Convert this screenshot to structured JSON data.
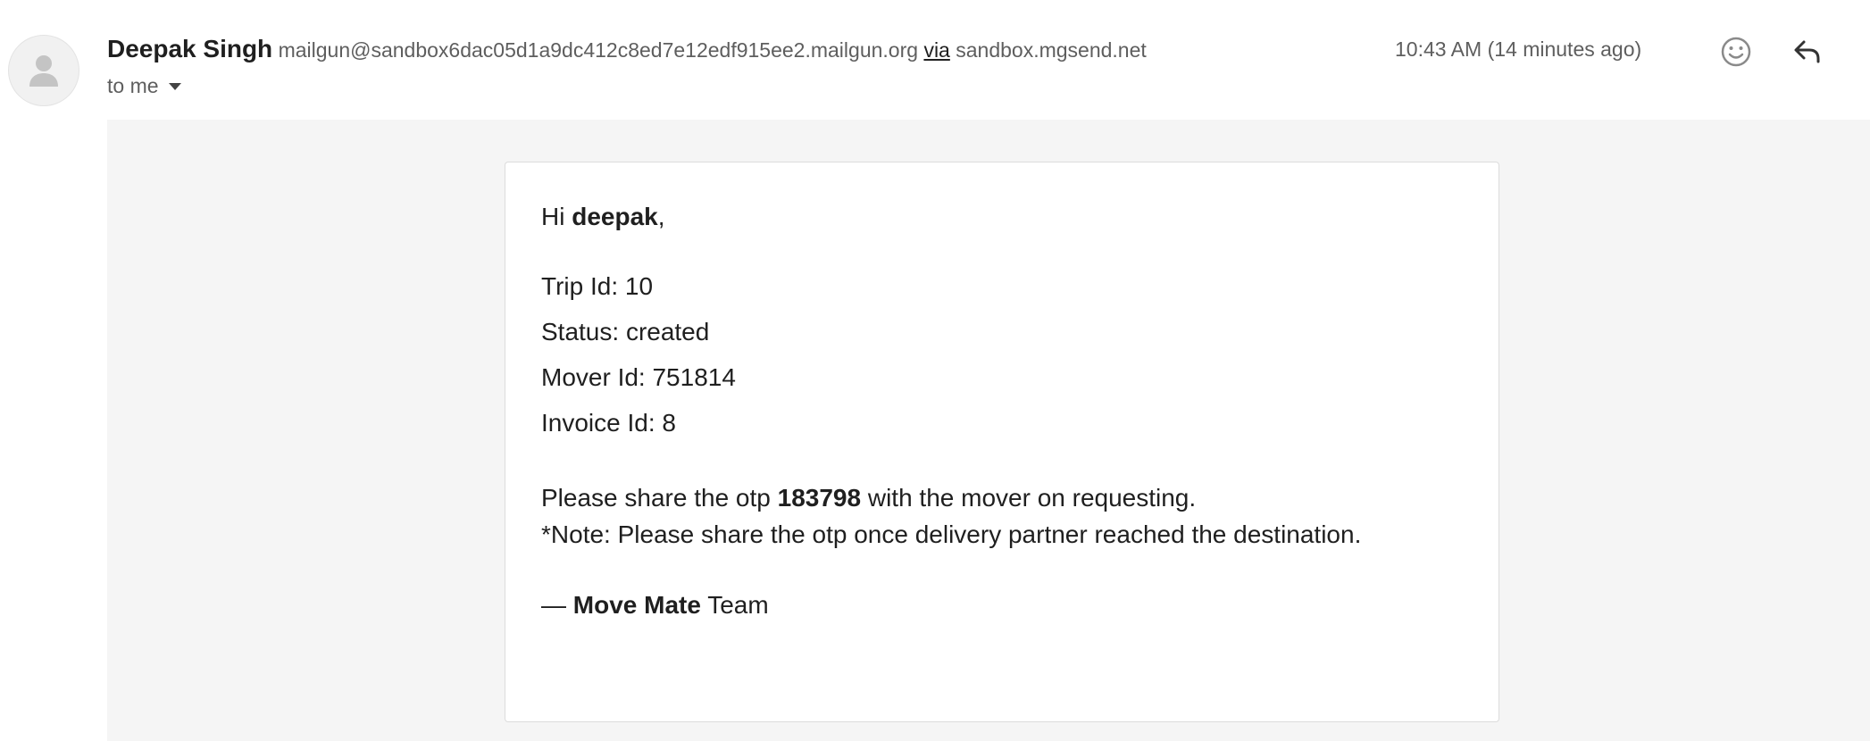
{
  "sender": {
    "name": "Deepak Singh",
    "email": "mailgun@sandbox6dac05d1a9dc412c8ed7e12edf915ee2.mailgun.org",
    "via_label": "via",
    "via_domain": "sandbox.mgsend.net"
  },
  "recipient": {
    "label": "to me"
  },
  "timestamp": "10:43 AM (14 minutes ago)",
  "icons": {
    "avatar": "person-icon",
    "emoji": "emoji-icon",
    "reply": "reply-icon",
    "dropdown": "caret-down-icon"
  },
  "message": {
    "greeting_prefix": "Hi ",
    "greeting_name": "deepak",
    "greeting_suffix": ",",
    "fields": [
      {
        "label": "Trip Id: ",
        "value": "10"
      },
      {
        "label": "Status: ",
        "value": "created"
      },
      {
        "label": "Mover Id: ",
        "value": "751814"
      },
      {
        "label": "Invoice Id: ",
        "value": "8"
      }
    ],
    "otp_prefix": "Please share the otp ",
    "otp": "183798",
    "otp_suffix": " with the mover on requesting.",
    "note": "*Note: Please share the otp once delivery partner reached the destination.",
    "signoff_dash": "— ",
    "signoff_brand": "Move Mate",
    "signoff_suffix": " Team"
  },
  "colors": {
    "message_background": "#f5f5f5",
    "card_background": "#ffffff",
    "secondary_text": "#5e5e5e",
    "primary_text": "#1f1f1f"
  }
}
